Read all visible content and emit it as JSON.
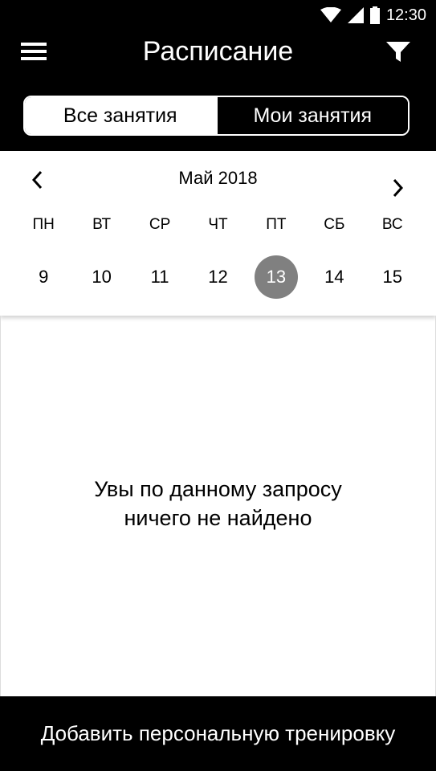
{
  "status_bar": {
    "time": "12:30",
    "icons": [
      "wifi-icon",
      "signal-icon",
      "battery-icon"
    ]
  },
  "header": {
    "title": "Расписание",
    "menu_icon": "hamburger-menu-icon",
    "filter_icon": "filter-icon"
  },
  "tabs": [
    {
      "label": "Все занятия",
      "active": true
    },
    {
      "label": "Мои занятия",
      "active": false
    }
  ],
  "calendar": {
    "month": "Май 2018",
    "weekdays": [
      "ПН",
      "ВТ",
      "СР",
      "ЧТ",
      "ПТ",
      "СБ",
      "ВС"
    ],
    "days": [
      "9",
      "10",
      "11",
      "12",
      "13",
      "14",
      "15"
    ],
    "selected_day": "13"
  },
  "empty_state": {
    "line1": "Увы по данному запросу",
    "line2": "ничего не найдено"
  },
  "bottom_action": {
    "label": "Добавить персональную тренировку"
  },
  "colors": {
    "header_bg": "#000000",
    "selected_day_bg": "#808080",
    "text_on_dark": "#ffffff"
  }
}
